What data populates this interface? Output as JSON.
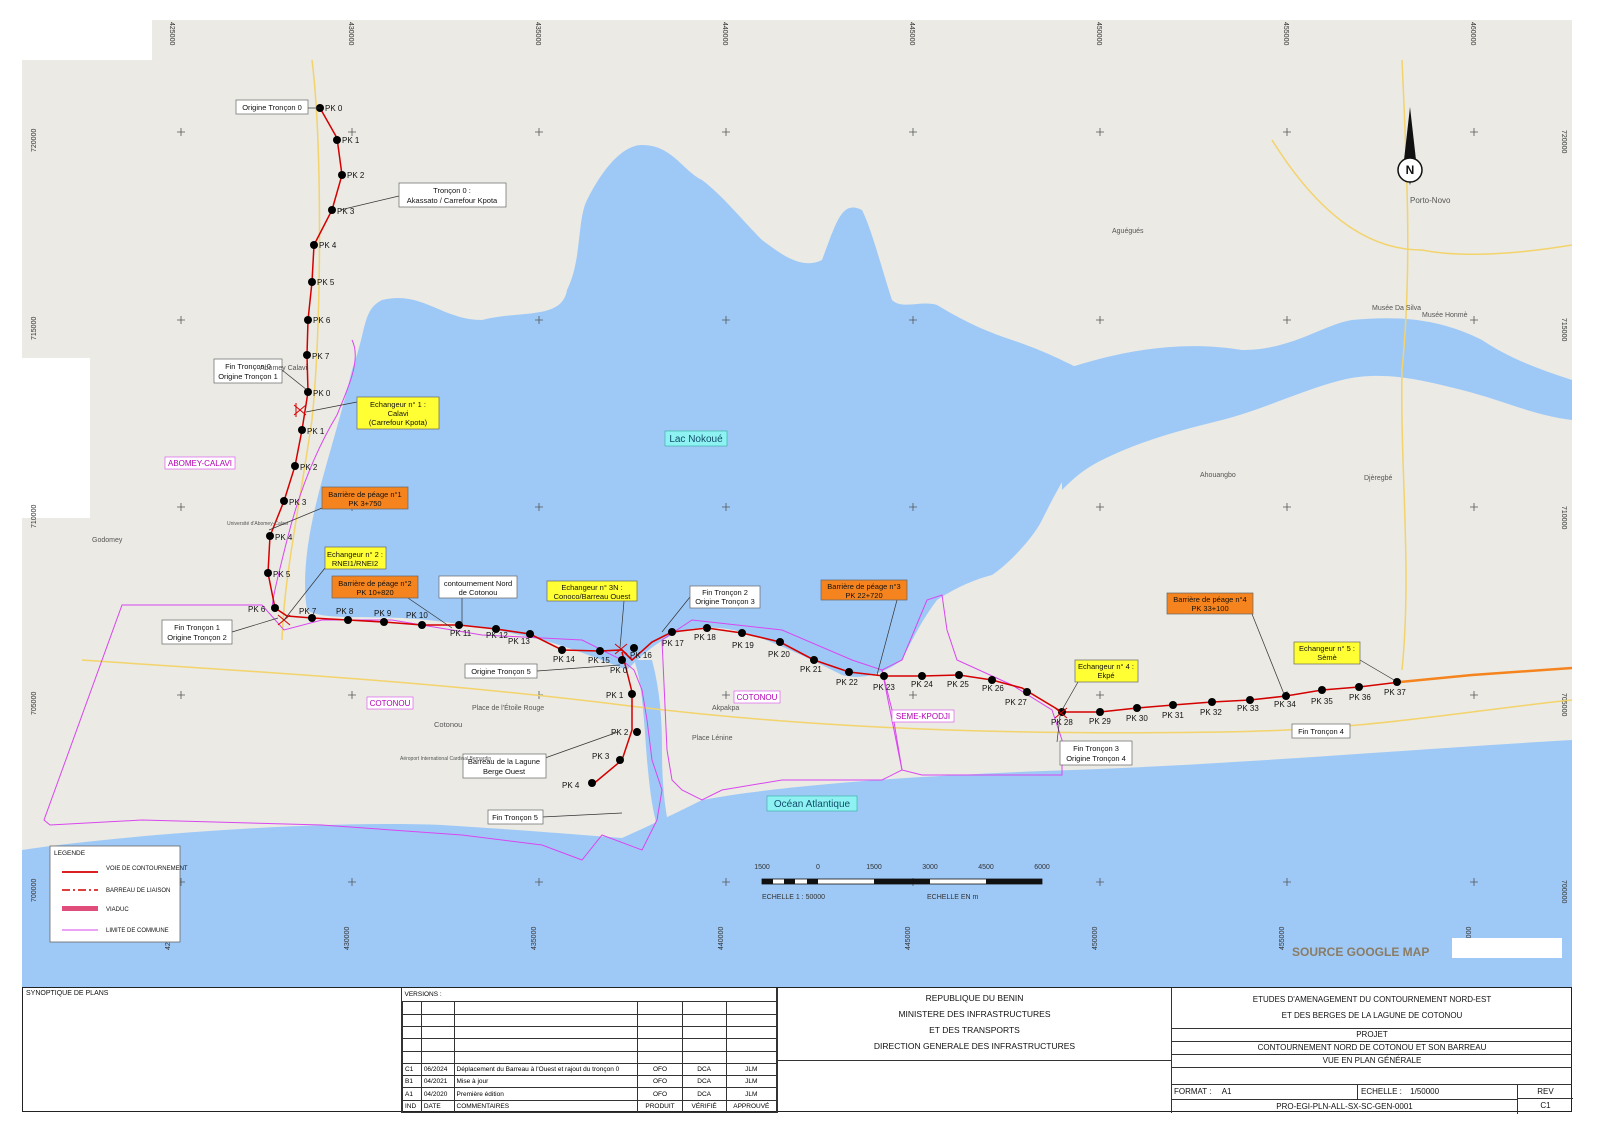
{
  "colors": {
    "water": "#9ec9f7",
    "land": "#ebeae4",
    "road_red": "#d40000",
    "orange_box": "#f5841f",
    "yellow_box": "#ffff33",
    "commune_limit": "#d946ef"
  },
  "map": {
    "lake_label": "Lac Nokoué",
    "ocean_label": "Océan Atlantique",
    "source": "SOURCE GOOGLE MAP",
    "north_letter": "N",
    "communes": [
      "ABOMEY-CALAVI",
      "COTONOU",
      "COTONOU",
      "SEME-KPODJI"
    ],
    "places": [
      "Porto-Novo",
      "Musée Da Silva",
      "Musée Honmè",
      "Djèregbé",
      "Aguégués",
      "Abomey Calavi",
      "Cotonou",
      "Place de l'Étoile Rouge",
      "Aéroport International Cardinal Bernardin",
      "Place Lénine",
      "Godomey",
      "Université d'Abomey-Calavi",
      "Ahouangbo",
      "Akpakpa"
    ],
    "coord_ticks_x": [
      "425000",
      "430000",
      "435000",
      "440000",
      "445000",
      "450000",
      "455000",
      "460000"
    ],
    "coord_ticks_y": [
      "720000",
      "715000",
      "710000",
      "705000",
      "700000"
    ],
    "pk_labels_t0": [
      "PK 0",
      "PK 1",
      "PK 2",
      "PK 3",
      "PK 4",
      "PK 5",
      "PK 6",
      "PK 7"
    ],
    "pk_labels_t1": [
      "PK 0",
      "PK 1",
      "PK 2",
      "PK 3",
      "PK 4",
      "PK 5",
      "PK 6",
      "PK 7",
      "PK 8",
      "PK 9",
      "PK 10",
      "PK 11",
      "PK 12",
      "PK 13",
      "PK 14",
      "PK 15",
      "PK 16",
      "PK 17",
      "PK 18",
      "PK 19",
      "PK 20",
      "PK 21",
      "PK 22",
      "PK 23",
      "PK 24",
      "PK 25",
      "PK 26",
      "PK 27",
      "PK 28",
      "PK 29",
      "PK 30",
      "PK 31",
      "PK 32",
      "PK 33",
      "PK 34",
      "PK 35",
      "PK 36",
      "PK 37"
    ],
    "pk_labels_t5": [
      "PK 0",
      "PK 1",
      "PK 2",
      "PK 3",
      "PK 4"
    ],
    "annotations": {
      "origine_t0": "Origine Tronçon 0",
      "troncon0": [
        "Tronçon 0 :",
        "Akassato / Carrefour Kpota"
      ],
      "fin_t0": [
        "Fin Tronçon 0",
        "Origine Tronçon 1"
      ],
      "echangeur1": [
        "Echangeur n° 1 :",
        "Calavi",
        "(Carrefour Kpota)"
      ],
      "peage1": [
        "Barrière de péage n°1",
        "PK 3+750"
      ],
      "echangeur2": [
        "Echangeur n° 2 :",
        "RNEI1/RNEI2"
      ],
      "peage2": [
        "Barrière de péage n°2",
        "PK 10+820"
      ],
      "contournement": [
        "contournement Nord",
        "de Cotonou"
      ],
      "echangeur3n": [
        "Echangeur n° 3N :",
        "Conoco/Barreau Ouest"
      ],
      "fin_t2": [
        "Fin Tronçon 2",
        "Origine Tronçon 3"
      ],
      "peage3": [
        "Barrière de péage n°3",
        "PK 22+720"
      ],
      "peage4": [
        "Barrière de péage n°4",
        "PK 33+100"
      ],
      "echangeur5": [
        "Echangeur n° 5 :",
        "Sèmè"
      ],
      "echangeur4": [
        "Echangeur n° 4 :",
        "Ekpé"
      ],
      "fin_t1": [
        "Fin Tronçon 1",
        "Origine Tronçon 2"
      ],
      "origine_t5": "Origine Tronçon 5",
      "barreau": [
        "Barreau de la Lagune",
        "Berge Ouest"
      ],
      "fin_t5": "Fin Tronçon 5",
      "fin_t3": [
        "Fin Tronçon 3",
        "Origine Tronçon 4"
      ],
      "fin_t4": "Fin Tronçon 4"
    },
    "scale": {
      "numbers": [
        "1500",
        "0",
        "1500",
        "3000",
        "4500",
        "6000"
      ],
      "left_caption": "ECHELLE   1 : 50000",
      "right_caption": "ECHELLE EN m"
    },
    "legend": {
      "title": "LEGENDE",
      "items": [
        "VOIE DE CONTOURNEMENT",
        "BARREAU DE LIAISON",
        "VIADUC",
        "LIMITE DE COMMUNE"
      ]
    }
  },
  "title_block": {
    "synoptique": "SYNOPTIQUE DE PLANS",
    "versions_label": "VERSIONS :",
    "versions": [
      {
        "rev": "C1",
        "date": "06/2024",
        "comment": "Déplacement du Barreau à l'Ouest et rajout du tronçon 0",
        "produit": "OFO",
        "verifie": "DCA",
        "approuve": "JLM"
      },
      {
        "rev": "B1",
        "date": "04/2021",
        "comment": "Mise à jour",
        "produit": "OFO",
        "verifie": "DCA",
        "approuve": "JLM"
      },
      {
        "rev": "A1",
        "date": "04/2020",
        "comment": "Première édition",
        "produit": "OFO",
        "verifie": "DCA",
        "approuve": "JLM"
      }
    ],
    "versions_header": {
      "rev": "IND",
      "date": "DATE",
      "comment": "COMMENTAIRES",
      "produit": "PRODUIT",
      "verifie": "VÉRIFIÉ",
      "approuve": "APPROUVÉ"
    },
    "ministry": [
      "REPUBLIQUE DU BENIN",
      "MINISTERE DES INFRASTRUCTURES",
      "ET DES TRANSPORTS",
      "DIRECTION GENERALE DES INFRASTRUCTURES"
    ],
    "study": [
      "ETUDES D'AMENAGEMENT DU CONTOURNEMENT NORD-EST",
      "ET DES BERGES DE LA LAGUNE DE COTONOU"
    ],
    "projet_label": "PROJET",
    "projet": [
      "CONTOURNEMENT NORD DE COTONOU ET SON BARREAU",
      "VUE EN PLAN GÉNÉRALE"
    ],
    "format_label": "FORMAT :",
    "format": "A1",
    "echelle_label": "ECHELLE :",
    "echelle": "1/50000",
    "rev_label": "REV",
    "rev": "C1",
    "doc_ref": "PRO-EGI-PLN-ALL-SX-SC-GEN-0001"
  }
}
